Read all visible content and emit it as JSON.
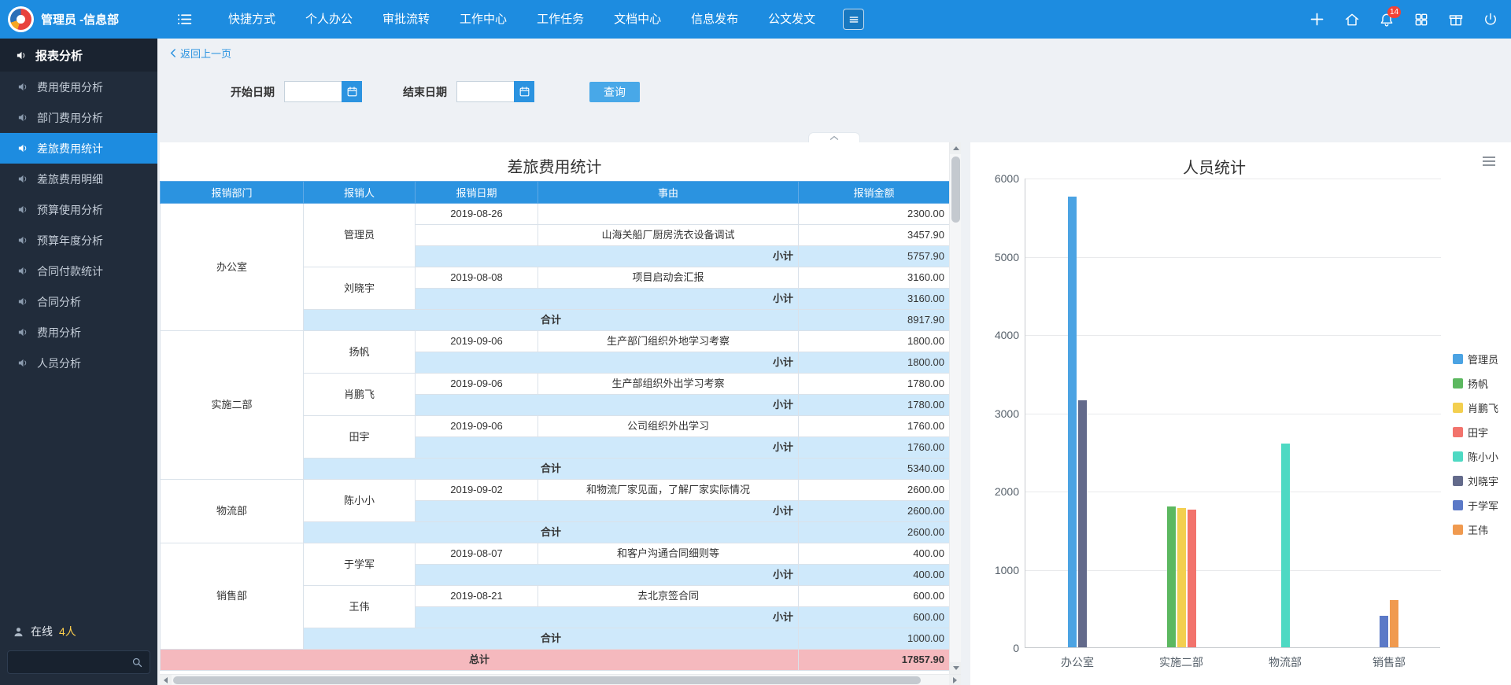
{
  "topbar": {
    "user": "管理员 -信息部",
    "menus": [
      "快捷方式",
      "个人办公",
      "审批流转",
      "工作中心",
      "工作任务",
      "文档中心",
      "信息发布",
      "公文发文"
    ],
    "bell_badge": "14"
  },
  "sidebar": {
    "section": "报表分析",
    "items": [
      {
        "label": "费用使用分析",
        "active": false
      },
      {
        "label": "部门费用分析",
        "active": false
      },
      {
        "label": "差旅费用统计",
        "active": true
      },
      {
        "label": "差旅费用明细",
        "active": false
      },
      {
        "label": "预算使用分析",
        "active": false
      },
      {
        "label": "预算年度分析",
        "active": false
      },
      {
        "label": "合同付款统计",
        "active": false
      },
      {
        "label": "合同分析",
        "active": false
      },
      {
        "label": "费用分析",
        "active": false
      },
      {
        "label": "人员分析",
        "active": false
      }
    ],
    "online_label": "在线",
    "online_count": "4人"
  },
  "breadcrumb": {
    "back": "返回上一页"
  },
  "filters": {
    "start_label": "开始日期",
    "end_label": "结束日期",
    "start_value": "",
    "end_value": "",
    "query_label": "查询"
  },
  "report": {
    "title": "差旅费用统计",
    "columns": [
      "报销部门",
      "报销人",
      "报销日期",
      "事由",
      "报销金额"
    ],
    "subtotal_label": "小计",
    "total_label": "合计",
    "grand_total_label": "总计",
    "grand_total": "17857.90",
    "groups": [
      {
        "department": "办公室",
        "people": [
          {
            "name": "管理员",
            "rows": [
              {
                "date": "2019-08-26",
                "reason": "",
                "amount": "2300.00"
              },
              {
                "date": "",
                "reason": "山海关船厂厨房洗衣设备调试",
                "amount": "3457.90"
              }
            ],
            "subtotal": "5757.90"
          },
          {
            "name": "刘晓宇",
            "rows": [
              {
                "date": "2019-08-08",
                "reason": "项目启动会汇报",
                "amount": "3160.00"
              }
            ],
            "subtotal": "3160.00"
          }
        ],
        "total": "8917.90"
      },
      {
        "department": "实施二部",
        "people": [
          {
            "name": "扬帆",
            "rows": [
              {
                "date": "2019-09-06",
                "reason": "生产部门组织外地学习考察",
                "amount": "1800.00"
              }
            ],
            "subtotal": "1800.00"
          },
          {
            "name": "肖鹏飞",
            "rows": [
              {
                "date": "2019-09-06",
                "reason": "生产部组织外出学习考察",
                "amount": "1780.00"
              }
            ],
            "subtotal": "1780.00"
          },
          {
            "name": "田宇",
            "rows": [
              {
                "date": "2019-09-06",
                "reason": "公司组织外出学习",
                "amount": "1760.00"
              }
            ],
            "subtotal": "1760.00"
          }
        ],
        "total": "5340.00"
      },
      {
        "department": "物流部",
        "people": [
          {
            "name": "陈小小",
            "rows": [
              {
                "date": "2019-09-02",
                "reason": "和物流厂家见面，了解厂家实际情况",
                "amount": "2600.00"
              }
            ],
            "subtotal": "2600.00"
          }
        ],
        "total": "2600.00"
      },
      {
        "department": "销售部",
        "people": [
          {
            "name": "于学军",
            "rows": [
              {
                "date": "2019-08-07",
                "reason": "和客户沟通合同细则等",
                "amount": "400.00"
              }
            ],
            "subtotal": "400.00"
          },
          {
            "name": "王伟",
            "rows": [
              {
                "date": "2019-08-21",
                "reason": "去北京签合同",
                "amount": "600.00"
              }
            ],
            "subtotal": "600.00"
          }
        ],
        "total": "1000.00"
      }
    ]
  },
  "chart_data": {
    "type": "bar",
    "title": "人员统计",
    "categories": [
      "办公室",
      "实施二部",
      "物流部",
      "销售部"
    ],
    "series": [
      {
        "name": "管理员",
        "color": "#4ba3e3",
        "values": [
          5757.9,
          0,
          0,
          0
        ]
      },
      {
        "name": "扬帆",
        "color": "#5cb860",
        "values": [
          0,
          1800,
          0,
          0
        ]
      },
      {
        "name": "肖鹏飞",
        "color": "#f3cf4f",
        "values": [
          0,
          1780,
          0,
          0
        ]
      },
      {
        "name": "田宇",
        "color": "#f2736c",
        "values": [
          0,
          1760,
          0,
          0
        ]
      },
      {
        "name": "陈小小",
        "color": "#4ed9c3",
        "values": [
          0,
          0,
          2600,
          0
        ]
      },
      {
        "name": "刘晓宇",
        "color": "#636a8b",
        "values": [
          3160,
          0,
          0,
          0
        ]
      },
      {
        "name": "于学军",
        "color": "#5b79c7",
        "values": [
          0,
          0,
          0,
          400
        ]
      },
      {
        "name": "王伟",
        "color": "#f09a4f",
        "values": [
          0,
          0,
          0,
          600
        ]
      }
    ],
    "ylim": [
      0,
      6000
    ],
    "ytick_step": 1000,
    "grid": true,
    "legend_position": "right"
  },
  "colors": {
    "accent": "#1d8ce0",
    "table_header_bg": "#2b93e0",
    "subtotal_row_bg": "#cfe9fb",
    "grand_total_row_bg": "#f5b9be",
    "badge": "#f44236"
  }
}
